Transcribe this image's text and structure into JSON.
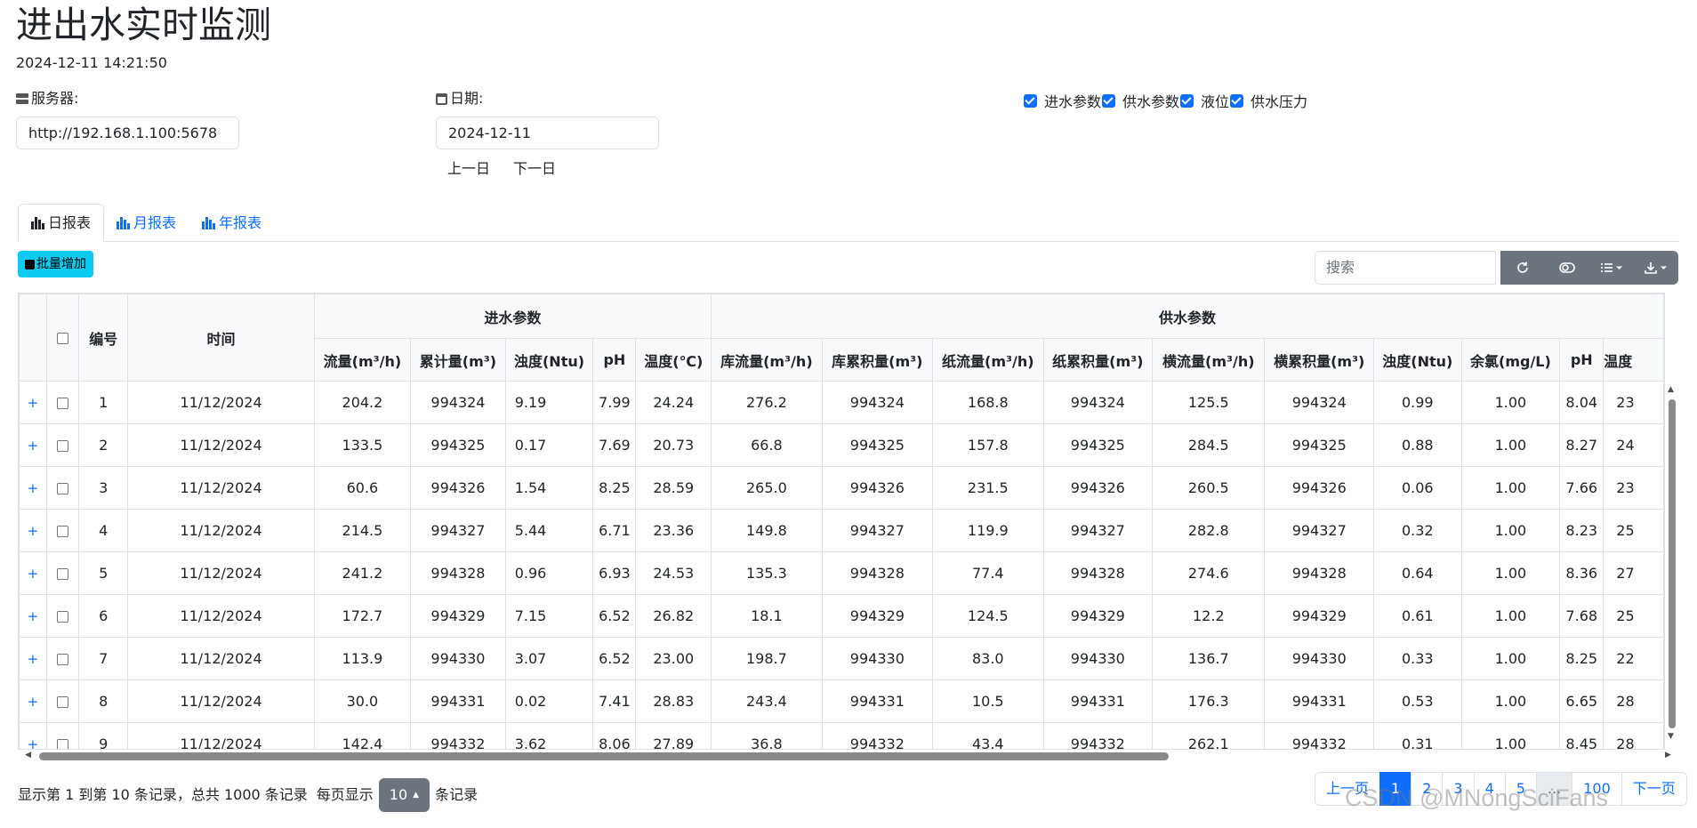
{
  "page": {
    "title": "进出水实时监测",
    "datetime": "2024-12-11 14:21:50"
  },
  "server": {
    "label": "服务器:",
    "value": "http://192.168.1.100:5678"
  },
  "date": {
    "label": "日期:",
    "value": "2024-12-11",
    "prev_label": "上一日",
    "next_label": "下一日"
  },
  "toggles": [
    "进水参数",
    "供水参数",
    "液位",
    "供水压力"
  ],
  "tabs": [
    "日报表",
    "月报表",
    "年报表"
  ],
  "toolbar": {
    "batch_add_label": "批量增加",
    "search_placeholder": "搜索"
  },
  "table": {
    "col_id": "编号",
    "col_time": "时间",
    "group_in": "进水参数",
    "group_supply": "供水参数",
    "in_columns": [
      "流量(m³/h)",
      "累计量(m³)",
      "浊度(Ntu)",
      "pH",
      "温度(℃)"
    ],
    "supply_columns": [
      "库流量(m³/h)",
      "库累积量(m³)",
      "纸流量(m³/h)",
      "纸累积量(m³)",
      "横流量(m³/h)",
      "横累积量(m³)",
      "浊度(Ntu)",
      "余氯(mg/L)",
      "pH",
      "温度"
    ],
    "rows": [
      [
        "1",
        "11/12/2024",
        "204.2",
        "994324",
        "9.19",
        "7.99",
        "24.24",
        "276.2",
        "994324",
        "168.8",
        "994324",
        "125.5",
        "994324",
        "0.99",
        "1.00",
        "8.04",
        "23"
      ],
      [
        "2",
        "11/12/2024",
        "133.5",
        "994325",
        "0.17",
        "7.69",
        "20.73",
        "66.8",
        "994325",
        "157.8",
        "994325",
        "284.5",
        "994325",
        "0.88",
        "1.00",
        "8.27",
        "24"
      ],
      [
        "3",
        "11/12/2024",
        "60.6",
        "994326",
        "1.54",
        "8.25",
        "28.59",
        "265.0",
        "994326",
        "231.5",
        "994326",
        "260.5",
        "994326",
        "0.06",
        "1.00",
        "7.66",
        "23"
      ],
      [
        "4",
        "11/12/2024",
        "214.5",
        "994327",
        "5.44",
        "6.71",
        "23.36",
        "149.8",
        "994327",
        "119.9",
        "994327",
        "282.8",
        "994327",
        "0.32",
        "1.00",
        "8.23",
        "25"
      ],
      [
        "5",
        "11/12/2024",
        "241.2",
        "994328",
        "0.96",
        "6.93",
        "24.53",
        "135.3",
        "994328",
        "77.4",
        "994328",
        "274.6",
        "994328",
        "0.64",
        "1.00",
        "8.36",
        "27"
      ],
      [
        "6",
        "11/12/2024",
        "172.7",
        "994329",
        "7.15",
        "6.52",
        "26.82",
        "18.1",
        "994329",
        "124.5",
        "994329",
        "12.2",
        "994329",
        "0.61",
        "1.00",
        "7.68",
        "25"
      ],
      [
        "7",
        "11/12/2024",
        "113.9",
        "994330",
        "3.07",
        "6.52",
        "23.00",
        "198.7",
        "994330",
        "83.0",
        "994330",
        "136.7",
        "994330",
        "0.33",
        "1.00",
        "8.25",
        "22"
      ],
      [
        "8",
        "11/12/2024",
        "30.0",
        "994331",
        "0.02",
        "7.41",
        "28.83",
        "243.4",
        "994331",
        "10.5",
        "994331",
        "176.3",
        "994331",
        "0.53",
        "1.00",
        "6.65",
        "28"
      ],
      [
        "9",
        "11/12/2024",
        "142.4",
        "994332",
        "3.62",
        "8.06",
        "27.89",
        "36.8",
        "994332",
        "43.4",
        "994332",
        "262.1",
        "994332",
        "0.31",
        "1.00",
        "8.45",
        "28"
      ]
    ]
  },
  "footer": {
    "info": "显示第 1 到第 10 条记录，总共 1000 条记录",
    "per_page_prefix": "每页显示",
    "per_page_value": "10",
    "per_page_suffix": "条记录"
  },
  "pagination": [
    "上一页",
    "1",
    "2",
    "3",
    "4",
    "5",
    "...",
    "100",
    "下一页"
  ],
  "watermark": "CSDN @MNongSciFans",
  "colors": {
    "primary": "#0d6efd",
    "info": "#0dcaf0",
    "secondary": "#6c757d"
  }
}
